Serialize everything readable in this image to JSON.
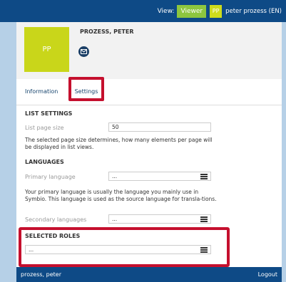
{
  "header": {
    "view_label": "View:",
    "viewer_button": "Viewer",
    "user_initials": "PP",
    "user_name": "peter prozess (EN)"
  },
  "profile": {
    "avatar_initials": "PP",
    "name": "PROZESS, PETER"
  },
  "tabs": {
    "information": "Information",
    "settings": "Settings"
  },
  "list_settings": {
    "title": "LIST SETTINGS",
    "page_size_label": "List page size",
    "page_size_value": "50",
    "description": "The selected page size determines, how many elements per page will be displayed in list views."
  },
  "languages": {
    "title": "LANGUAGES",
    "primary_label": "Primary language",
    "primary_value": "...",
    "primary_description": "Your primary language is usually the language you mainly use in Symbio. This language is used as the source language for transla-tions.",
    "secondary_label": "Secondary languages",
    "secondary_value": "..."
  },
  "selected_roles": {
    "title": "SELECTED ROLES",
    "value": "..."
  },
  "footer": {
    "user": "prozess, peter",
    "logout": "Logout"
  }
}
